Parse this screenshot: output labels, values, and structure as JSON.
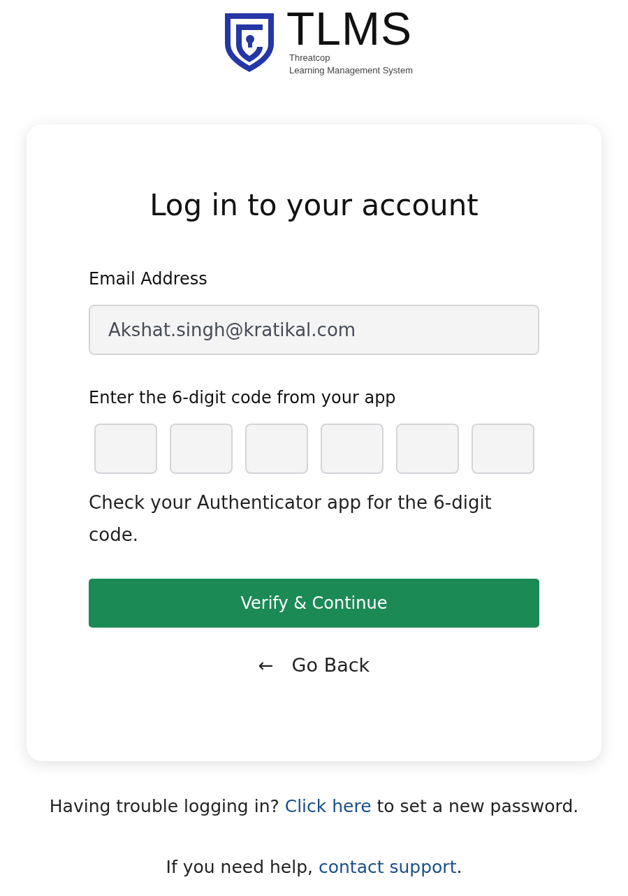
{
  "logo": {
    "wordmark": "TLMS",
    "tagline_1": "Threatcop",
    "tagline_2": "Learning Management System"
  },
  "card": {
    "title": "Log in to your account",
    "email": {
      "label": "Email Address",
      "value": "Akshat.singh@kratikal.com",
      "disabled": true
    },
    "code": {
      "label": "Enter the 6-digit code from your app",
      "boxes": [
        {
          "focused": false
        },
        {
          "focused": false
        },
        {
          "focused": false
        },
        {
          "focused": false
        },
        {
          "focused": false
        },
        {
          "focused": false
        }
      ],
      "hint": "Check your Authenticator app for the 6-digit code."
    },
    "submit_button": "Verify & Continue",
    "back_link": {
      "arrow": "←",
      "label": "Go Back"
    }
  },
  "footer": [
    {
      "before": "Having trouble logging in? ",
      "link": "Click here",
      "after": " to set a new password."
    },
    {
      "before": "If you need help, ",
      "link": "contact support",
      "after": "."
    }
  ]
}
